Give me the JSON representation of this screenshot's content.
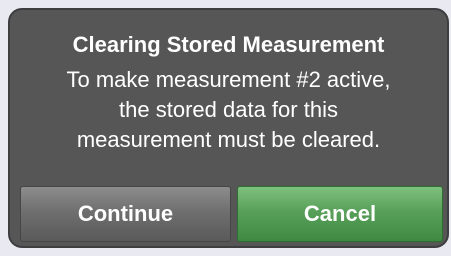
{
  "dialog": {
    "title": "Clearing Stored Measurement",
    "message_lines": [
      "To make measurement #2 active,",
      "the stored data for this",
      "measurement must be cleared."
    ],
    "buttons": {
      "continue_label": "Continue",
      "cancel_label": "Cancel"
    }
  },
  "colors": {
    "dialog_background": "#565657",
    "continue_button": "#6f6f70",
    "cancel_button": "#58a059",
    "text": "#ffffff"
  }
}
